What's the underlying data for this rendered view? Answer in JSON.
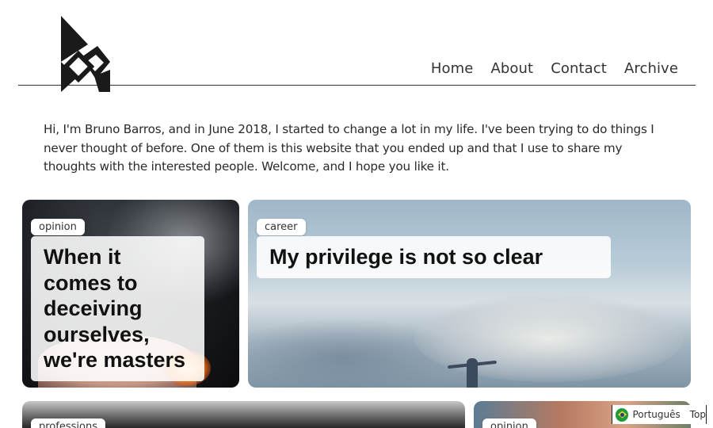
{
  "header": {
    "logo": "diamond-logo",
    "nav": [
      "Home",
      "About",
      "Contact",
      "Archive"
    ]
  },
  "intro": "Hi, I'm Bruno Barros, and in June 2018, I started to change a lot in my life. I've been trying to do things I never thought of before. One of them is this website that you ended up and that I use to share my thoughts with the interested people. Welcome, and I hope you like it.",
  "posts": [
    {
      "tag": "opinion",
      "title": "When it comes to deceiving ourselves, we're masters",
      "image": "burning-cards-photo"
    },
    {
      "tag": "career",
      "title": "My privilege is not so clear",
      "image": "sky-person-photo"
    },
    {
      "tag": "professions",
      "title": "",
      "image": "dog-photo"
    },
    {
      "tag": "opinion",
      "title": "",
      "image": "street-photo"
    }
  ],
  "footer_bar": {
    "language_icon": "brazil-flag-icon",
    "language": "Português",
    "top": "Top"
  }
}
